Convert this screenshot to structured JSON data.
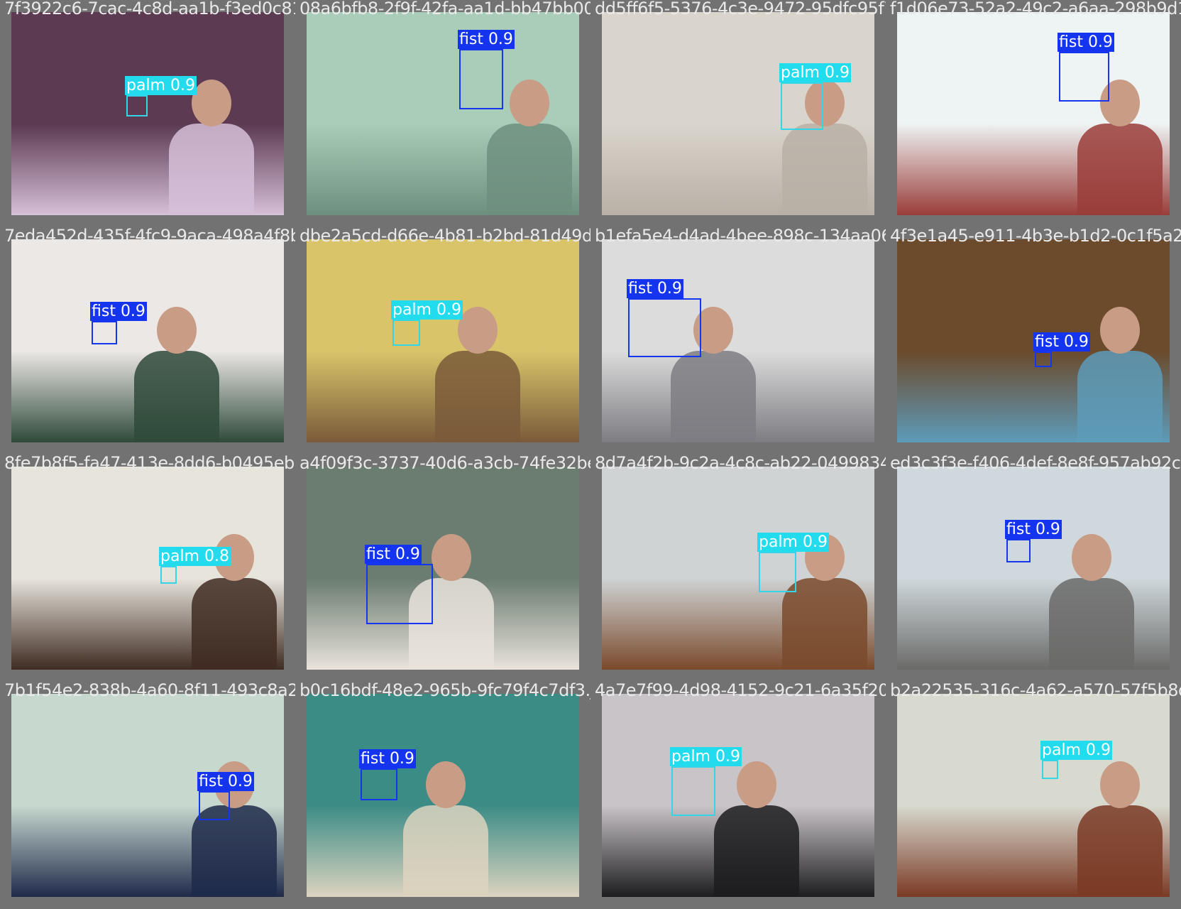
{
  "mosaic": {
    "tiles": [
      {
        "filename": "7f3922c6-7cac-4c8d-aa1b-f3ed0c81fa4f.jpg",
        "photo_tone": [
          "#5b3a52",
          "#d6c0d8"
        ],
        "detections": [
          {
            "label": "palm 0.9",
            "cls": "palm"
          }
        ]
      },
      {
        "filename": "08a6bfb8-2f9f-42fa-aa1d-bb47bb00b322.jpg",
        "photo_tone": [
          "#a9cdb8",
          "#6e8f7f"
        ],
        "detections": [
          {
            "label": "fist 0.9",
            "cls": "fist"
          }
        ]
      },
      {
        "filename": "dd5ff6f5-5376-4c3e-9472-95dfc95f7600.jpg",
        "photo_tone": [
          "#d9d4cc",
          "#b9b0a6"
        ],
        "detections": [
          {
            "label": "palm 0.9",
            "cls": "palm"
          }
        ]
      },
      {
        "filename": "f1d06e73-52a2-49c2-a6aa-298b9d1c2a5e.jpg",
        "photo_tone": [
          "#eef3f3",
          "#9a3d3a"
        ],
        "detections": [
          {
            "label": "fist 0.9",
            "cls": "fist"
          }
        ]
      },
      {
        "filename": "7eda452d-435f-4fc9-9aca-498a4f8b4245.jpg",
        "photo_tone": [
          "#ece8e6",
          "#2f4a3a"
        ],
        "detections": [
          {
            "label": "fist 0.9",
            "cls": "fist"
          }
        ]
      },
      {
        "filename": "dbe2a5cd-d66e-4b81-b2bd-81d49d1f1354.jpg",
        "photo_tone": [
          "#d9c46a",
          "#7a5a3a"
        ],
        "detections": [
          {
            "label": "palm 0.9",
            "cls": "palm"
          }
        ]
      },
      {
        "filename": "b1efa5e4-d4ad-4bee-898c-134aa06475d5.jpg",
        "photo_tone": [
          "#dcdcdc",
          "#7c7c82"
        ],
        "detections": [
          {
            "label": "fist 0.9",
            "cls": "fist"
          }
        ]
      },
      {
        "filename": "4f3e1a45-e911-4b3e-b1d2-0c1f5a2e8d9b.jpg",
        "photo_tone": [
          "#6c4a2c",
          "#5d9bb9"
        ],
        "detections": [
          {
            "label": "fist 0.9",
            "cls": "fist"
          }
        ]
      },
      {
        "filename": "8fe7b8f5-fa47-413e-8dd6-b0495eba0d8e.jpg",
        "photo_tone": [
          "#e7e4dc",
          "#3f2b22"
        ],
        "detections": [
          {
            "label": "palm 0.8",
            "cls": "palm"
          }
        ]
      },
      {
        "filename": "a4f09f3c-3737-40d6-a3cb-74fe32be972a.jpg",
        "photo_tone": [
          "#6b7c70",
          "#e9e3dc"
        ],
        "detections": [
          {
            "label": "fist 0.9",
            "cls": "fist"
          }
        ]
      },
      {
        "filename": "8d7a4f2b-9c2a-4c8c-ab22-0499834d4f87.jpg",
        "photo_tone": [
          "#cfd3d4",
          "#7a4a2c"
        ],
        "detections": [
          {
            "label": "palm 0.9",
            "cls": "palm"
          }
        ]
      },
      {
        "filename": "ed3c3f3e-f406-4def-8e8f-957ab92c61a1.jpg",
        "photo_tone": [
          "#cfd8dc",
          "#6a6a68"
        ],
        "detections": [
          {
            "label": "fist 0.9",
            "cls": "fist"
          }
        ]
      },
      {
        "filename": "7b1f54e2-838b-4a60-8f11-493c8a20d806.jpg",
        "photo_tone": [
          "#c7d8cf",
          "#1f2a4a"
        ],
        "detections": [
          {
            "label": "fist 0.9",
            "cls": "fist"
          }
        ]
      },
      {
        "filename": "b0c16bdf-48e2-965b-9fc79f4c7df3.jpg",
        "photo_tone": [
          "#3c8c86",
          "#ddd4c0"
        ],
        "detections": [
          {
            "label": "fist 0.9",
            "cls": "fist"
          }
        ]
      },
      {
        "filename": "4a7e7f99-4d98-4152-9c21-6a35f2076c85.jpg",
        "photo_tone": [
          "#c9c4c8",
          "#1c1c1e"
        ],
        "detections": [
          {
            "label": "palm 0.9",
            "cls": "palm"
          }
        ]
      },
      {
        "filename": "b2a22535-316c-4a62-a570-57f5b8d3a2e1.jpg",
        "photo_tone": [
          "#d8dad0",
          "#7a3a24"
        ],
        "detections": [
          {
            "label": "palm 0.9",
            "cls": "palm"
          }
        ]
      }
    ]
  }
}
